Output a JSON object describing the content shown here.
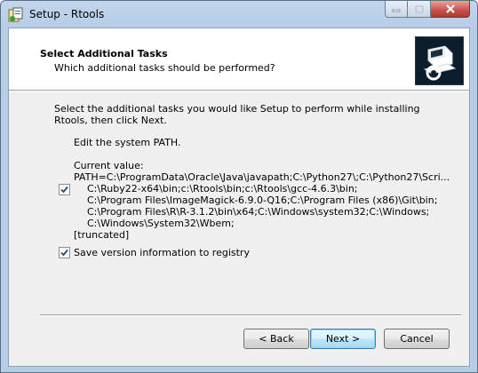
{
  "window": {
    "title": "Setup - Rtools"
  },
  "header": {
    "title": "Select Additional Tasks",
    "subtitle": "Which additional tasks should be performed?"
  },
  "body": {
    "intro": "Select the additional tasks you would like Setup to perform while installing Rtools, then click Next.",
    "group_label": "Edit the system PATH.",
    "tasks": [
      {
        "checked": true,
        "lines": [
          "Current value:",
          "PATH=C:\\ProgramData\\Oracle\\Java\\javapath;C:\\Python27\\;C:\\Python27\\Scri...",
          "C:\\Ruby22-x64\\bin;c:\\Rtools\\bin;c:\\Rtools\\gcc-4.6.3\\bin;",
          "C:\\Program Files\\ImageMagick-6.9.0-Q16;C:\\Program Files (x86)\\Git\\bin;",
          "C:\\Program Files\\R\\R-3.1.2\\bin\\x64;C:\\Windows\\system32;C:\\Windows;",
          "C:\\Windows\\System32\\Wbem;",
          "[truncated]"
        ]
      },
      {
        "checked": true,
        "label": "Save version information to registry"
      }
    ]
  },
  "buttons": {
    "back": "< Back",
    "next": "Next >",
    "cancel": "Cancel"
  }
}
